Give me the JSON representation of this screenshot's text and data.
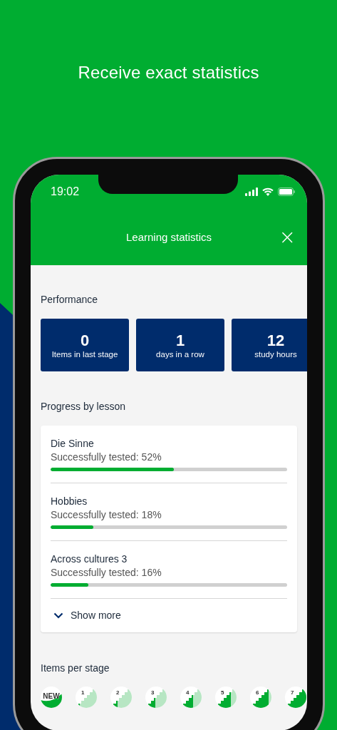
{
  "headline": "Receive exact statistics",
  "status_bar": {
    "time": "19:02"
  },
  "nav_bar": {
    "title": "Learning statistics",
    "close": "×"
  },
  "performance": {
    "title": "Performance",
    "stats": [
      {
        "value": "0",
        "label": "Items in last stage"
      },
      {
        "value": "1",
        "label": "days in a row"
      },
      {
        "value": "12",
        "label": "study hours"
      }
    ]
  },
  "progress": {
    "title": "Progress by lesson",
    "lessons": [
      {
        "name": "Die Sinne",
        "subtitle": "Successfully tested: 52%",
        "level": 0.52
      },
      {
        "name": "Hobbies",
        "subtitle": "Successfully tested: 18%",
        "level": 0.18
      },
      {
        "name": "Across cultures 3",
        "subtitle": "Successfully tested: 16%",
        "level": 0.16
      }
    ],
    "show_more": "Show more"
  },
  "stages": {
    "title": "Items per stage",
    "items": [
      {
        "kind": "new",
        "label": "NEW"
      },
      {
        "kind": "stage",
        "label": "1"
      },
      {
        "kind": "stage",
        "label": "2"
      },
      {
        "kind": "stage",
        "label": "3"
      },
      {
        "kind": "stage",
        "label": "4"
      },
      {
        "kind": "stage",
        "label": "5"
      },
      {
        "kind": "stage",
        "label": "6"
      },
      {
        "kind": "stage",
        "label": "7"
      }
    ]
  }
}
